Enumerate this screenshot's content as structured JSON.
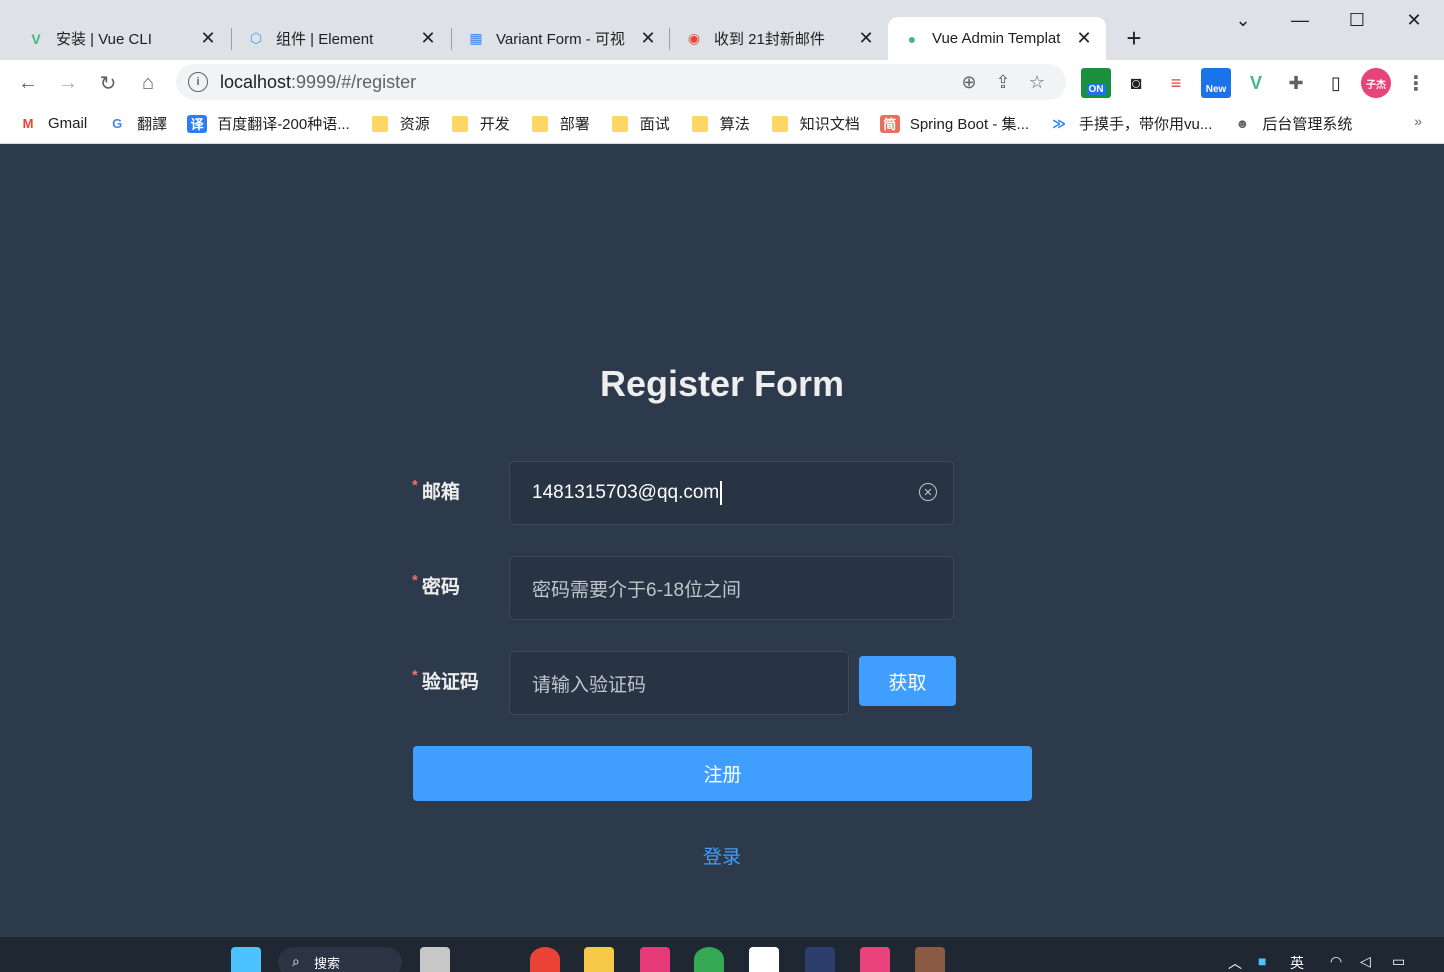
{
  "browser": {
    "tabs": [
      {
        "title": "安装 | Vue CLI",
        "favicon": "vue-icon",
        "color": "#42b883",
        "active": false
      },
      {
        "title": "组件 | Element",
        "favicon": "element-icon",
        "color": "#409eff",
        "active": false
      },
      {
        "title": "Variant Form - 可视",
        "favicon": "variant-form-icon",
        "color": "#3b82f6",
        "active": false
      },
      {
        "title": "收到 21封新邮件",
        "favicon": "mail-icon",
        "color": "#ea4335",
        "active": false
      },
      {
        "title": "Vue Admin Templat",
        "favicon": "vue-admin-icon",
        "color": "#42b883",
        "active": true
      }
    ],
    "url_host": "localhost",
    "url_path": ":9999/#/register",
    "bookmarks": [
      {
        "label": "Gmail",
        "icon": "gmail-icon"
      },
      {
        "label": "翻譯",
        "icon": "google-translate-icon"
      },
      {
        "label": "百度翻译-200种语...",
        "icon": "baidu-translate-icon"
      },
      {
        "label": "资源",
        "icon": "folder-icon"
      },
      {
        "label": "开发",
        "icon": "folder-icon"
      },
      {
        "label": "部署",
        "icon": "folder-icon"
      },
      {
        "label": "面试",
        "icon": "folder-icon"
      },
      {
        "label": "算法",
        "icon": "folder-icon"
      },
      {
        "label": "知识文档",
        "icon": "folder-icon"
      },
      {
        "label": "Spring Boot - 集...",
        "icon": "jianshu-icon"
      },
      {
        "label": "手摸手，带你用vu...",
        "icon": "bookmark-icon"
      },
      {
        "label": "后台管理系统",
        "icon": "user-icon"
      }
    ],
    "ext_on_label": "ON",
    "ext_new_label": "New",
    "profile_label": "子杰",
    "more_bookmarks": "»"
  },
  "form": {
    "title": "Register Form",
    "email_label": "邮箱",
    "email_value": "1481315703@qq.com",
    "password_label": "密码",
    "password_placeholder": "密码需要介于6-18位之间",
    "code_label": "验证码",
    "code_placeholder": "请输入验证码",
    "get_code_label": "获取",
    "register_label": "注册",
    "login_link": "登录",
    "required_mark": "*"
  },
  "taskbar": {
    "search_label": "搜索",
    "ime_label": "英"
  },
  "colors": {
    "page_bg": "#2d3a4b",
    "primary": "#409eff",
    "required": "#f56c6c"
  }
}
